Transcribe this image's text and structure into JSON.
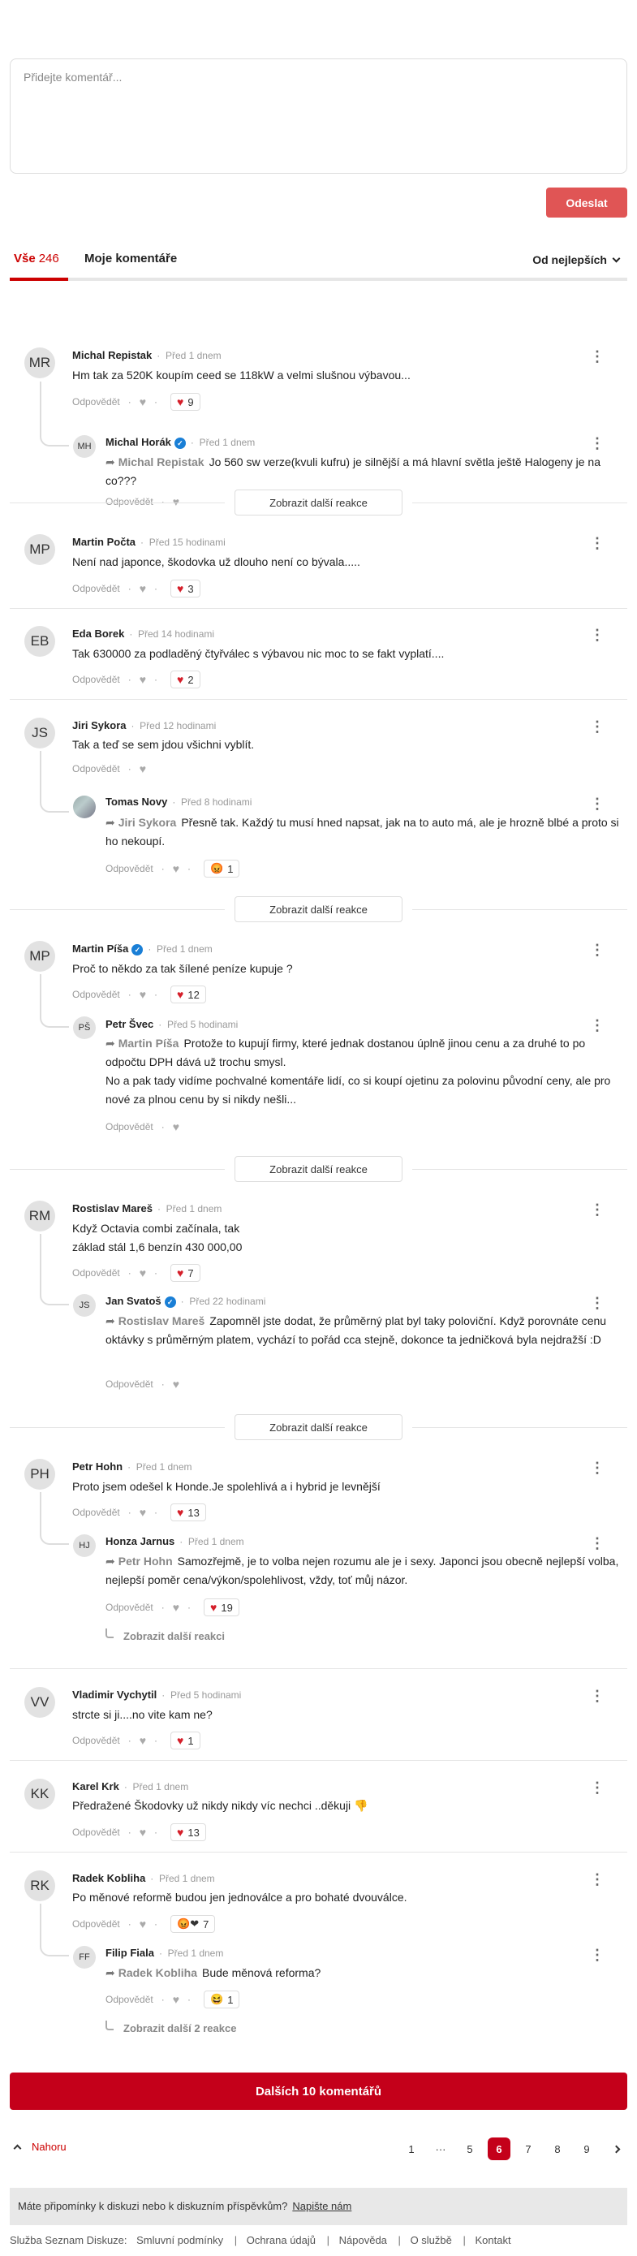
{
  "compose": {
    "placeholder": "Přidejte komentář...",
    "send_label": "Odeslat"
  },
  "tabs": {
    "all_label": "Vše",
    "all_count": "246",
    "mine_label": "Moje komentáře",
    "sort_label": "Od nejlepších"
  },
  "common": {
    "reply": "Odpovědět",
    "show_more_reactions": "Zobrazit další reakce"
  },
  "comments": [
    {
      "initials": "MR",
      "name": "Michal Repistak",
      "time": "Před 1 dnem",
      "text": "Hm tak za 520K koupím ceed se 118kW a velmi slušnou výbavou...",
      "likes": "9"
    },
    {
      "initials": "MH",
      "name": "Michal Horák",
      "time": "Před 1 dnem",
      "reply_to": "Michal Repistak",
      "text": "Jo 560 sw verze(kvuli kufru) je silnější a má hlavní světla ještě Halogeny je na co???"
    },
    {
      "initials": "MP",
      "name": "Martin Počta",
      "time": "Před 15 hodinami",
      "text": "Není nad japonce, škodovka už dlouho není co bývala.....",
      "likes": "3"
    },
    {
      "initials": "EB",
      "name": "Eda Borek",
      "time": "Před 14 hodinami",
      "text": "Tak 630000 za podladěný čtyřválec s výbavou nic moc to se fakt vyplatí....",
      "likes": "2"
    },
    {
      "initials": "JS",
      "name": "Jiri Sykora",
      "time": "Před 12 hodinami",
      "text": "Tak a teď se sem jdou všichni vyblít."
    },
    {
      "initials": "",
      "name": "Tomas Novy",
      "time": "Před 8 hodinami",
      "reply_to": "Jiri Sykora",
      "text": "Přesně tak. Každý tu musí hned napsat, jak na to auto má, ale je hrozně blbé a proto si ho nekoupí.",
      "reaction": "😡",
      "likes": "1"
    },
    {
      "initials": "MP",
      "name": "Martin Píša",
      "time": "Před 1 dnem",
      "text": "Proč to někdo za tak šílené peníze kupuje ?",
      "likes": "12"
    },
    {
      "initials": "PŠ",
      "name": "Petr Švec",
      "time": "Před 5 hodinami",
      "reply_to": "Martin Píša",
      "text": "Protože to kupují firmy, které jednak dostanou úplně jinou cenu a za druhé to po odpočtu DPH dává už trochu smysl.",
      "text2": "No a pak tady vidíme pochvalné komentáře lidí, co si koupí ojetinu za polovinu původní ceny, ale pro nové za plnou cenu by si nikdy nešli..."
    },
    {
      "initials": "RM",
      "name": "Rostislav Mareš",
      "time": "Před 1 dnem",
      "text": "Když Octavia combi začínala, tak",
      "text2": "základ stál 1,6 benzín 430 000,00",
      "likes": "7"
    },
    {
      "initials": "JS",
      "name": "Jan Svatoš",
      "time": "Před 22 hodinami",
      "reply_to": "Rostislav Mareš",
      "text": "Zapomněl jste dodat, že průměrný plat byl taky poloviční. Když porovnáte cenu oktávky s průměrným platem, vychází to pořád cca stejně, dokonce ta jedničková byla nejdražší :D"
    },
    {
      "initials": "PH",
      "name": "Petr Hohn",
      "time": "Před 1 dnem",
      "text": "Proto jsem odešel k Honde.Je spolehlivá a i hybrid je levnější",
      "likes": "13"
    },
    {
      "initials": "HJ",
      "name": "Honza Jarnus",
      "time": "Před 1 dnem",
      "reply_to": "Petr Hohn",
      "text": "Samozřejmě, je to volba nejen rozumu ale je i sexy. Japonci jsou obecně nejlepší volba, nejlepší poměr cena/výkon/spolehlivost, vždy, toť můj názor.",
      "likes": "19",
      "more": "Zobrazit další reakci"
    },
    {
      "initials": "VV",
      "name": "Vladimir Vychytil",
      "time": "Před 5 hodinami",
      "text": "strcte si ji....no vite kam ne?",
      "likes": "1"
    },
    {
      "initials": "KK",
      "name": "Karel Krk",
      "time": "Před 1 dnem",
      "text": "Předražené Škodovky už nikdy nikdy víc nechci ..děkuji 👎",
      "likes": "13"
    },
    {
      "initials": "RK",
      "name": "Radek Kobliha",
      "time": "Před 1 dnem",
      "text": "Po měnové reformě budou jen jednoválce a pro bohaté dvouválce.",
      "reaction": "😡❤",
      "likes": "7"
    },
    {
      "initials": "FF",
      "name": "Filip Fiala",
      "time": "Před 1 dnem",
      "reply_to": "Radek Kobliha",
      "text": "Bude měnová reforma?",
      "reaction": "😆",
      "likes": "1",
      "more": "Zobrazit další 2 reakce"
    }
  ],
  "load_more": "Dalších 10 komentářů",
  "pager": {
    "top": "Nahoru",
    "pages": [
      "1",
      "···",
      "5",
      "6",
      "7",
      "8",
      "9"
    ],
    "active": "6"
  },
  "feedback": {
    "text": "Máte připomínky k diskuzi nebo k diskuzním příspěvkům?",
    "link": "Napište nám"
  },
  "footer": {
    "prefix": "Služba Seznam Diskuze:",
    "links": [
      "Smluvní podmínky",
      "Ochrana údajů",
      "Nápověda",
      "O službě",
      "Kontakt"
    ]
  }
}
